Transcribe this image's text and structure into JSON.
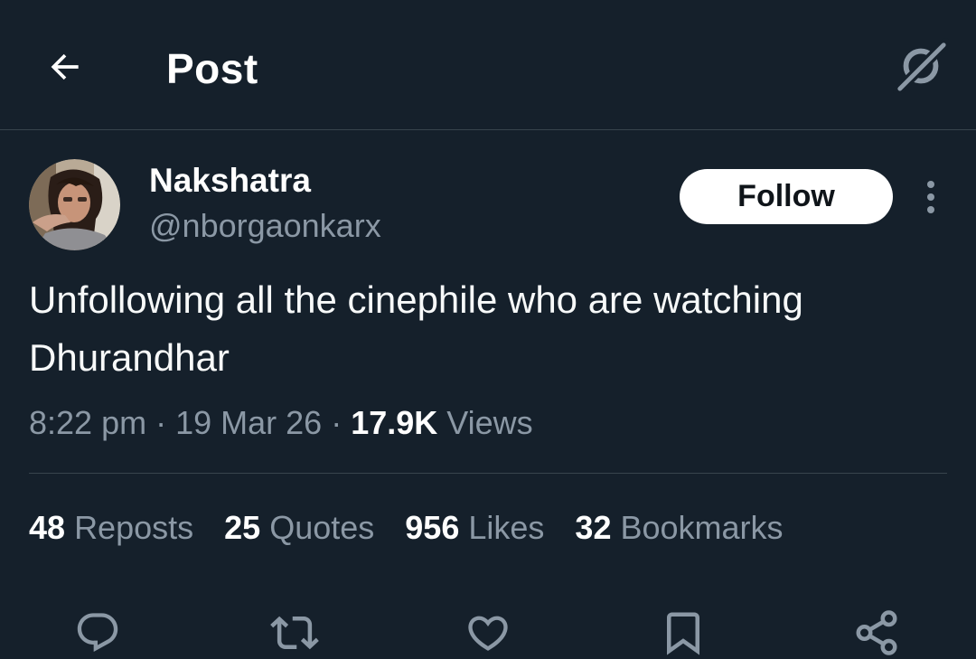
{
  "header": {
    "title": "Post",
    "back_icon": "arrow-left-icon",
    "grok_icon": "grok-icon"
  },
  "author": {
    "display_name": "Nakshatra",
    "handle": "@nborgaonkarx"
  },
  "follow_label": "Follow",
  "tweet": {
    "text": "Unfollowing all the cinephile who are watching Dhurandhar",
    "time": "8:22 pm",
    "date": "19 Mar 26",
    "views_count": "17.9K",
    "views_label": "Views"
  },
  "stats": {
    "reposts": {
      "count": "48",
      "label": "Reposts"
    },
    "quotes": {
      "count": "25",
      "label": "Quotes"
    },
    "likes": {
      "count": "956",
      "label": "Likes"
    },
    "bookmarks": {
      "count": "32",
      "label": "Bookmarks"
    }
  },
  "actions": [
    "reply-icon",
    "repost-icon",
    "like-icon",
    "bookmark-icon",
    "share-icon"
  ],
  "colors": {
    "background": "#15202b",
    "secondary_text": "#8b98a5",
    "divider": "#38444d",
    "follow_bg": "#ffffff"
  }
}
